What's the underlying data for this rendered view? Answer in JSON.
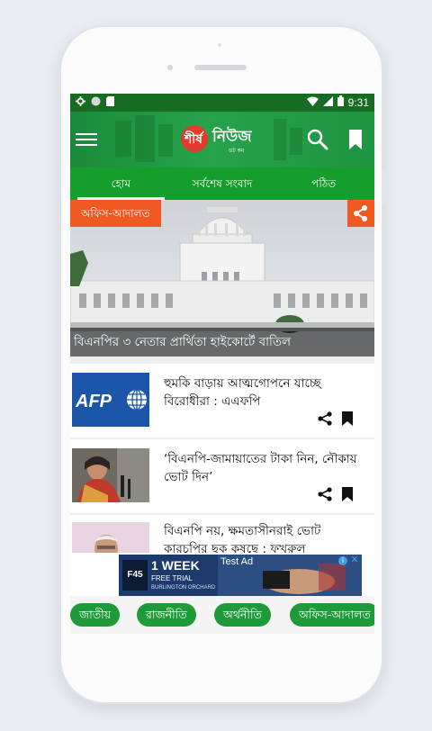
{
  "status_bar": {
    "time": "9:31"
  },
  "app": {
    "logo_text": "শীর্ষ",
    "logo_news": "নিউজ",
    "logo_sub": "ডট কম",
    "brand_color": "#159e2c"
  },
  "tabs": [
    {
      "label": "হোম",
      "active": true
    },
    {
      "label": "সর্বশেষ সংবাদ",
      "active": false
    },
    {
      "label": "পঠিত",
      "active": false
    }
  ],
  "hero": {
    "category": "অফিস-আদালত",
    "headline": "বিএনপির ৩ নেতার প্রার্থিতা হাইকোর্টে বাতিল"
  },
  "news": [
    {
      "title": "হুমকি বাড়ায় আত্মগোপনে যাচ্ছে বিরোধীরা : এএফপি",
      "thumb_text": "AFP"
    },
    {
      "title": "‘বিএনপি-জামায়াতের টাকা নিন, নৌকায় ভোট দিন’"
    },
    {
      "title": "বিএনপি নয়, ক্ষমতাসীনরাই ভোট কারচুপির ছক কষছে : ফখরুল"
    }
  ],
  "ad": {
    "label": "Test Ad",
    "brand": "F45",
    "headline": "1 WEEK",
    "sub": "FREE TRIAL",
    "location": "BURLINGTON ORCHARD"
  },
  "categories": [
    {
      "label": "জাতীয়"
    },
    {
      "label": "রাজনীতি"
    },
    {
      "label": "অর্থনীতি"
    },
    {
      "label": "অফিস-আদালত"
    }
  ]
}
